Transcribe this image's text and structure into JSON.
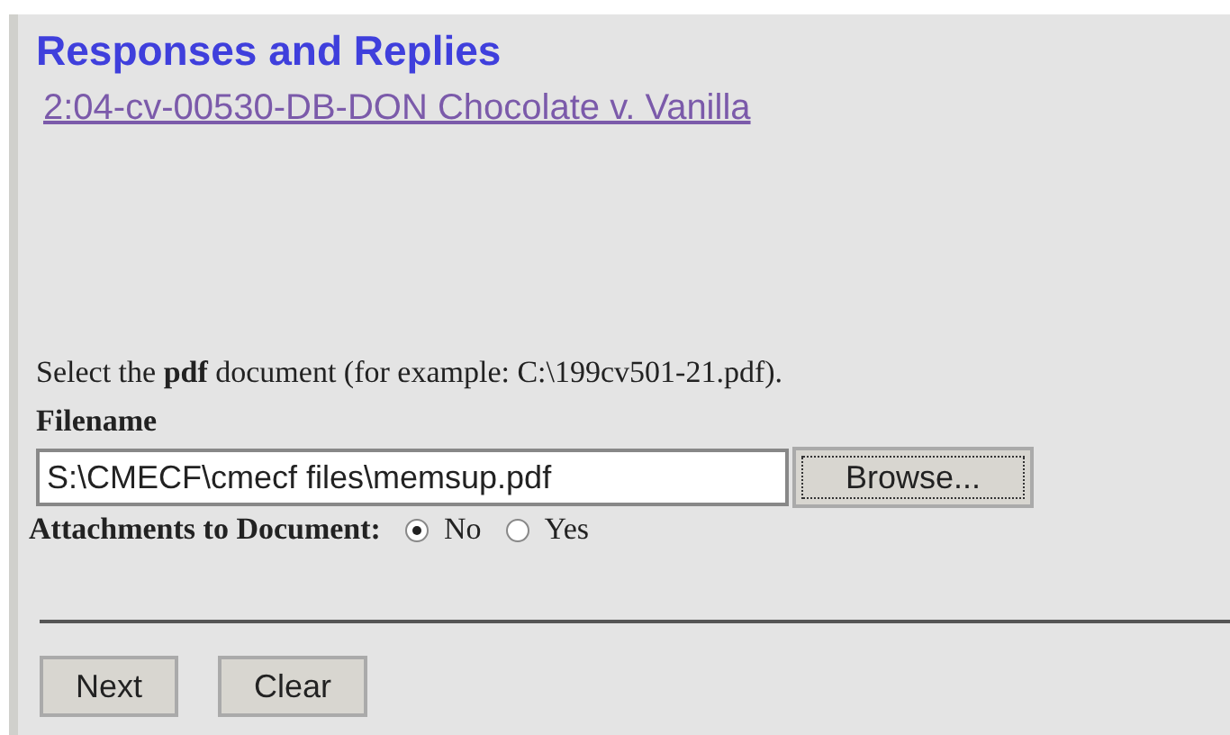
{
  "title": "Responses and Replies",
  "case_link": "2:04-cv-00530-DB-DON Chocolate v. Vanilla",
  "instruction": "Select the **pdf** document (for example: C:\\199cv501-21.pdf).",
  "filename": {
    "label": "Filename",
    "value": "S:\\CMECF\\cmecf files\\memsup.pdf",
    "button": "Browse..."
  },
  "attachments": {
    "label": "Attachments to Document:",
    "options": [
      {
        "label": "No",
        "selected": true
      },
      {
        "label": "Yes",
        "selected": false
      }
    ]
  },
  "buttons": [
    "Next",
    "Clear"
  ]
}
